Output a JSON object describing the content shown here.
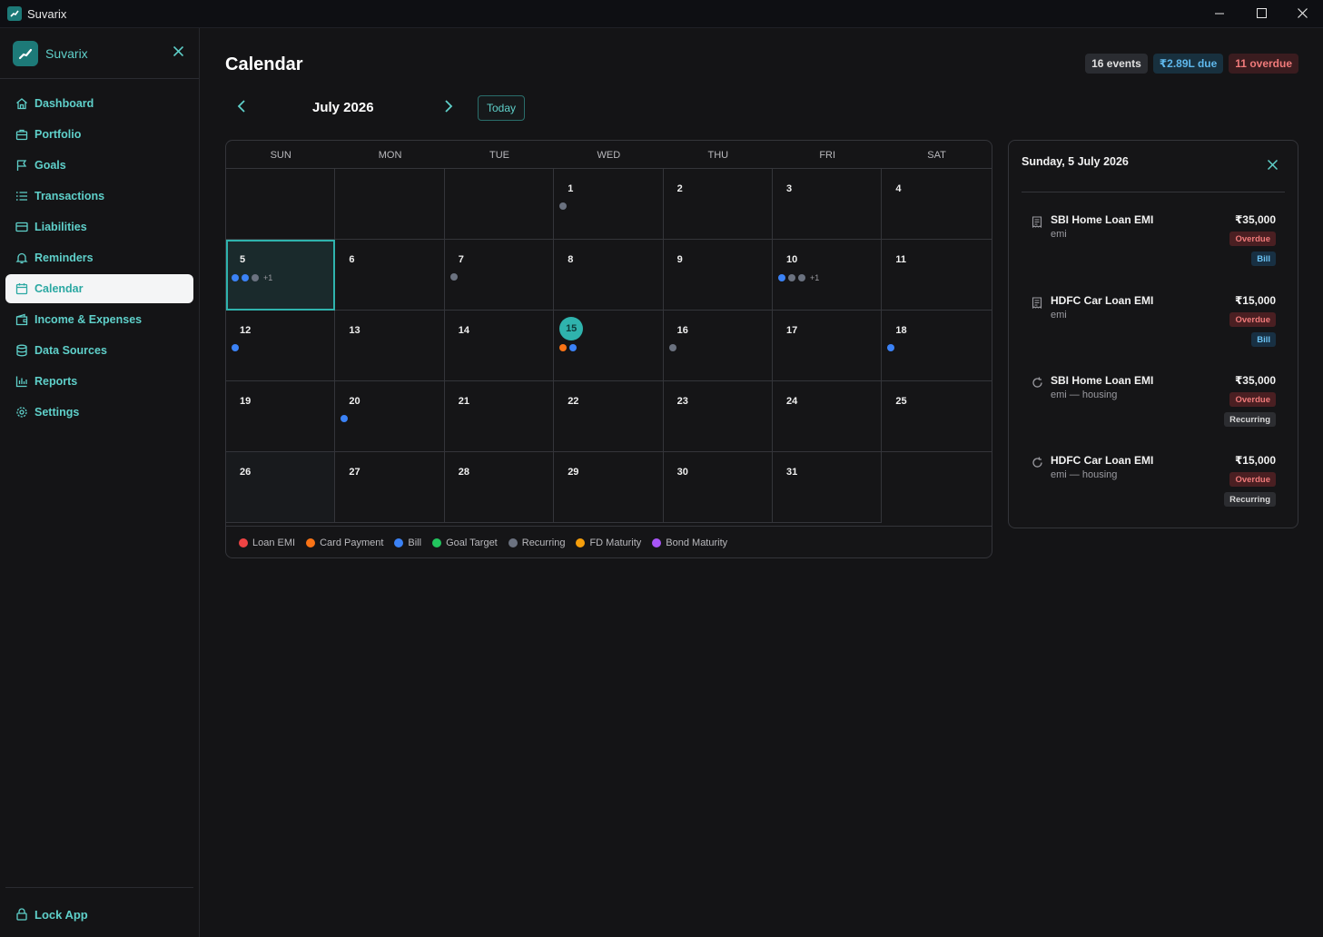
{
  "window": {
    "title": "Suvarix"
  },
  "sidebar": {
    "brand": "Suvarix",
    "items": [
      {
        "label": "Dashboard",
        "icon": "home-icon"
      },
      {
        "label": "Portfolio",
        "icon": "briefcase-icon"
      },
      {
        "label": "Goals",
        "icon": "flag-icon"
      },
      {
        "label": "Transactions",
        "icon": "list-icon"
      },
      {
        "label": "Liabilities",
        "icon": "credit-card-icon"
      },
      {
        "label": "Reminders",
        "icon": "bell-icon"
      },
      {
        "label": "Calendar",
        "icon": "calendar-icon",
        "active": true
      },
      {
        "label": "Income & Expenses",
        "icon": "wallet-icon"
      },
      {
        "label": "Data Sources",
        "icon": "database-icon"
      },
      {
        "label": "Reports",
        "icon": "bar-chart-icon"
      },
      {
        "label": "Settings",
        "icon": "gear-icon"
      }
    ],
    "lock_label": "Lock App"
  },
  "header": {
    "title": "Calendar",
    "chips": {
      "events": "16 events",
      "due": "₹2.89L due",
      "overdue": "11 overdue"
    }
  },
  "month_nav": {
    "label": "July 2026",
    "today_button": "Today"
  },
  "calendar": {
    "weekdays": [
      "SUN",
      "MON",
      "TUE",
      "WED",
      "THU",
      "FRI",
      "SAT"
    ],
    "weeks": [
      [
        {
          "day": ""
        },
        {
          "day": ""
        },
        {
          "day": ""
        },
        {
          "day": "1",
          "dots": [
            "recurring"
          ]
        },
        {
          "day": "2"
        },
        {
          "day": "3"
        },
        {
          "day": "4"
        }
      ],
      [
        {
          "day": "5",
          "dots": [
            "bill",
            "bill",
            "recurring"
          ],
          "more": "+1",
          "selected": true
        },
        {
          "day": "6"
        },
        {
          "day": "7",
          "dots": [
            "recurring"
          ]
        },
        {
          "day": "8"
        },
        {
          "day": "9"
        },
        {
          "day": "10",
          "dots": [
            "bill",
            "recurring",
            "recurring"
          ],
          "more": "+1"
        },
        {
          "day": "11"
        }
      ],
      [
        {
          "day": "12",
          "dots": [
            "bill"
          ]
        },
        {
          "day": "13"
        },
        {
          "day": "14"
        },
        {
          "day": "15",
          "dots": [
            "card",
            "bill"
          ],
          "today": true
        },
        {
          "day": "16",
          "dots": [
            "recurring"
          ]
        },
        {
          "day": "17"
        },
        {
          "day": "18",
          "dots": [
            "bill"
          ]
        }
      ],
      [
        {
          "day": "19"
        },
        {
          "day": "20",
          "dots": [
            "bill"
          ]
        },
        {
          "day": "21"
        },
        {
          "day": "22"
        },
        {
          "day": "23"
        },
        {
          "day": "24"
        },
        {
          "day": "25"
        }
      ],
      [
        {
          "day": "26",
          "dim": true
        },
        {
          "day": "27"
        },
        {
          "day": "28"
        },
        {
          "day": "29"
        },
        {
          "day": "30"
        },
        {
          "day": "31"
        },
        {
          "day": "",
          "empty_end": true
        }
      ]
    ],
    "legend": [
      {
        "key": "loan",
        "label": "Loan EMI",
        "color": "#ef4444"
      },
      {
        "key": "card",
        "label": "Card Payment",
        "color": "#f97316"
      },
      {
        "key": "bill",
        "label": "Bill",
        "color": "#3b82f6"
      },
      {
        "key": "goal",
        "label": "Goal Target",
        "color": "#22c55e"
      },
      {
        "key": "recurring",
        "label": "Recurring",
        "color": "#6b7280"
      },
      {
        "key": "fd",
        "label": "FD Maturity",
        "color": "#f59e0b"
      },
      {
        "key": "bond",
        "label": "Bond Maturity",
        "color": "#a855f7"
      }
    ]
  },
  "panel": {
    "title": "Sunday, 5 July 2026",
    "events": [
      {
        "name": "SBI Home Loan EMI",
        "sub": "emi",
        "amount": "₹35,000",
        "status": "Overdue",
        "tag": "Bill",
        "tag_kind": "bill",
        "icon": "receipt-icon"
      },
      {
        "name": "HDFC Car Loan EMI",
        "sub": "emi",
        "amount": "₹15,000",
        "status": "Overdue",
        "tag": "Bill",
        "tag_kind": "bill",
        "icon": "receipt-icon"
      },
      {
        "name": "SBI Home Loan EMI",
        "sub": "emi — housing",
        "amount": "₹35,000",
        "status": "Overdue",
        "tag": "Recurring",
        "tag_kind": "recurring",
        "icon": "refresh-icon"
      },
      {
        "name": "HDFC Car Loan EMI",
        "sub": "emi — housing",
        "amount": "₹15,000",
        "status": "Overdue",
        "tag": "Recurring",
        "tag_kind": "recurring",
        "icon": "refresh-icon"
      }
    ]
  }
}
